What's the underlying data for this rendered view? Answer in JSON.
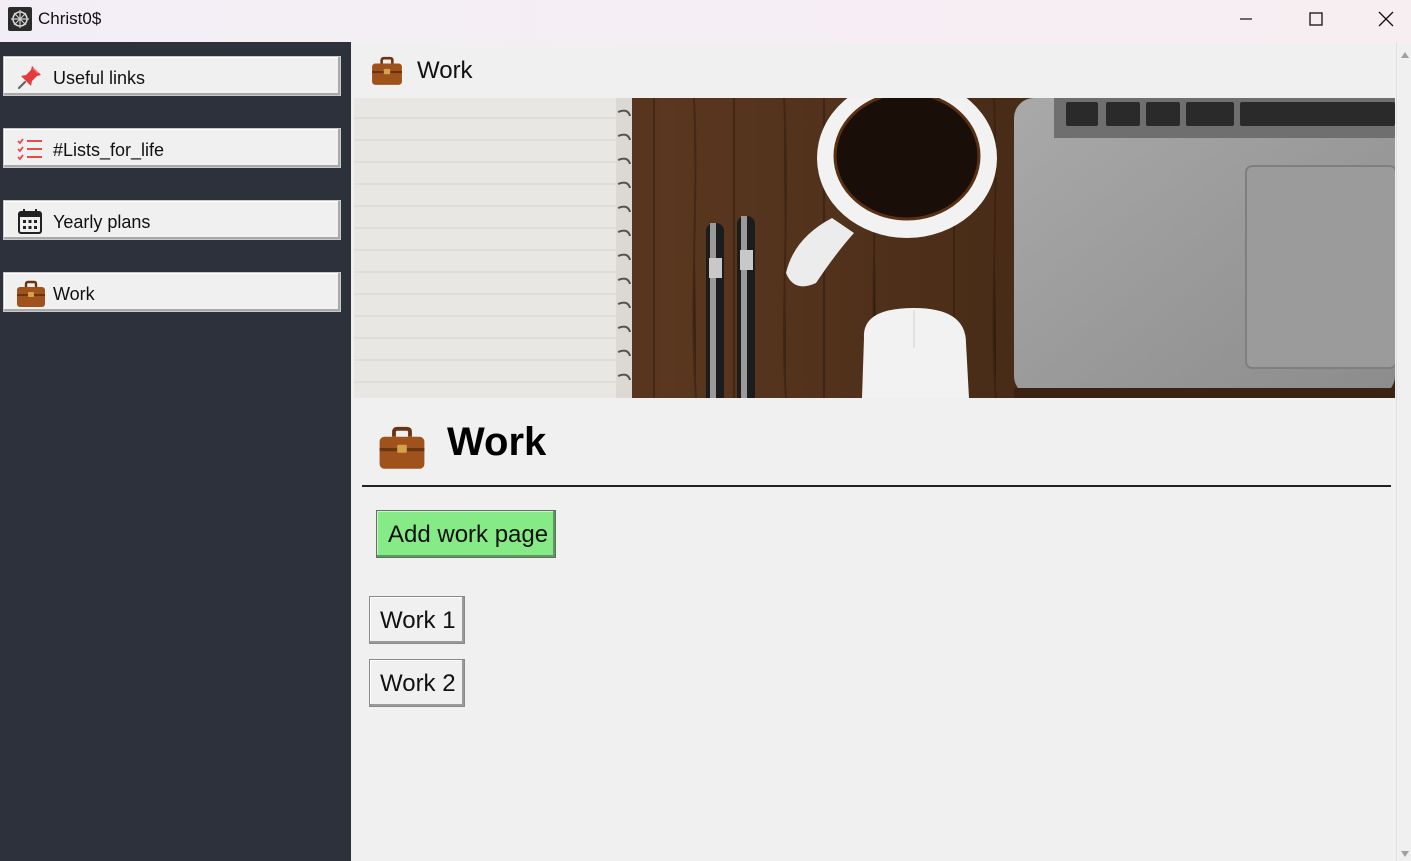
{
  "window": {
    "title": "Christ0$",
    "icon": "app-logo-icon",
    "controls": [
      "minimize-icon",
      "maximize-icon",
      "close-icon"
    ]
  },
  "sidebar": {
    "items": [
      {
        "label": "Useful links",
        "icon": "pushpin-icon"
      },
      {
        "label": "#Lists_for_life",
        "icon": "checklist-icon"
      },
      {
        "label": "Yearly plans",
        "icon": "calendar-icon"
      },
      {
        "label": "Work",
        "icon": "briefcase-icon"
      }
    ]
  },
  "main": {
    "breadcrumb": {
      "label": "Work",
      "icon": "briefcase-icon"
    },
    "banner": {
      "icon": "desk-photo-banner"
    },
    "page": {
      "title": "Work",
      "icon": "briefcase-icon",
      "add_button_label": "Add work page",
      "subpages": [
        "Work 1",
        "Work 2"
      ]
    }
  },
  "colors": {
    "sidebar_bg": "#2c313c",
    "content_bg": "#f0f0f0",
    "add_button_bg": "#86ea86",
    "briefcase": "#a0521d"
  }
}
